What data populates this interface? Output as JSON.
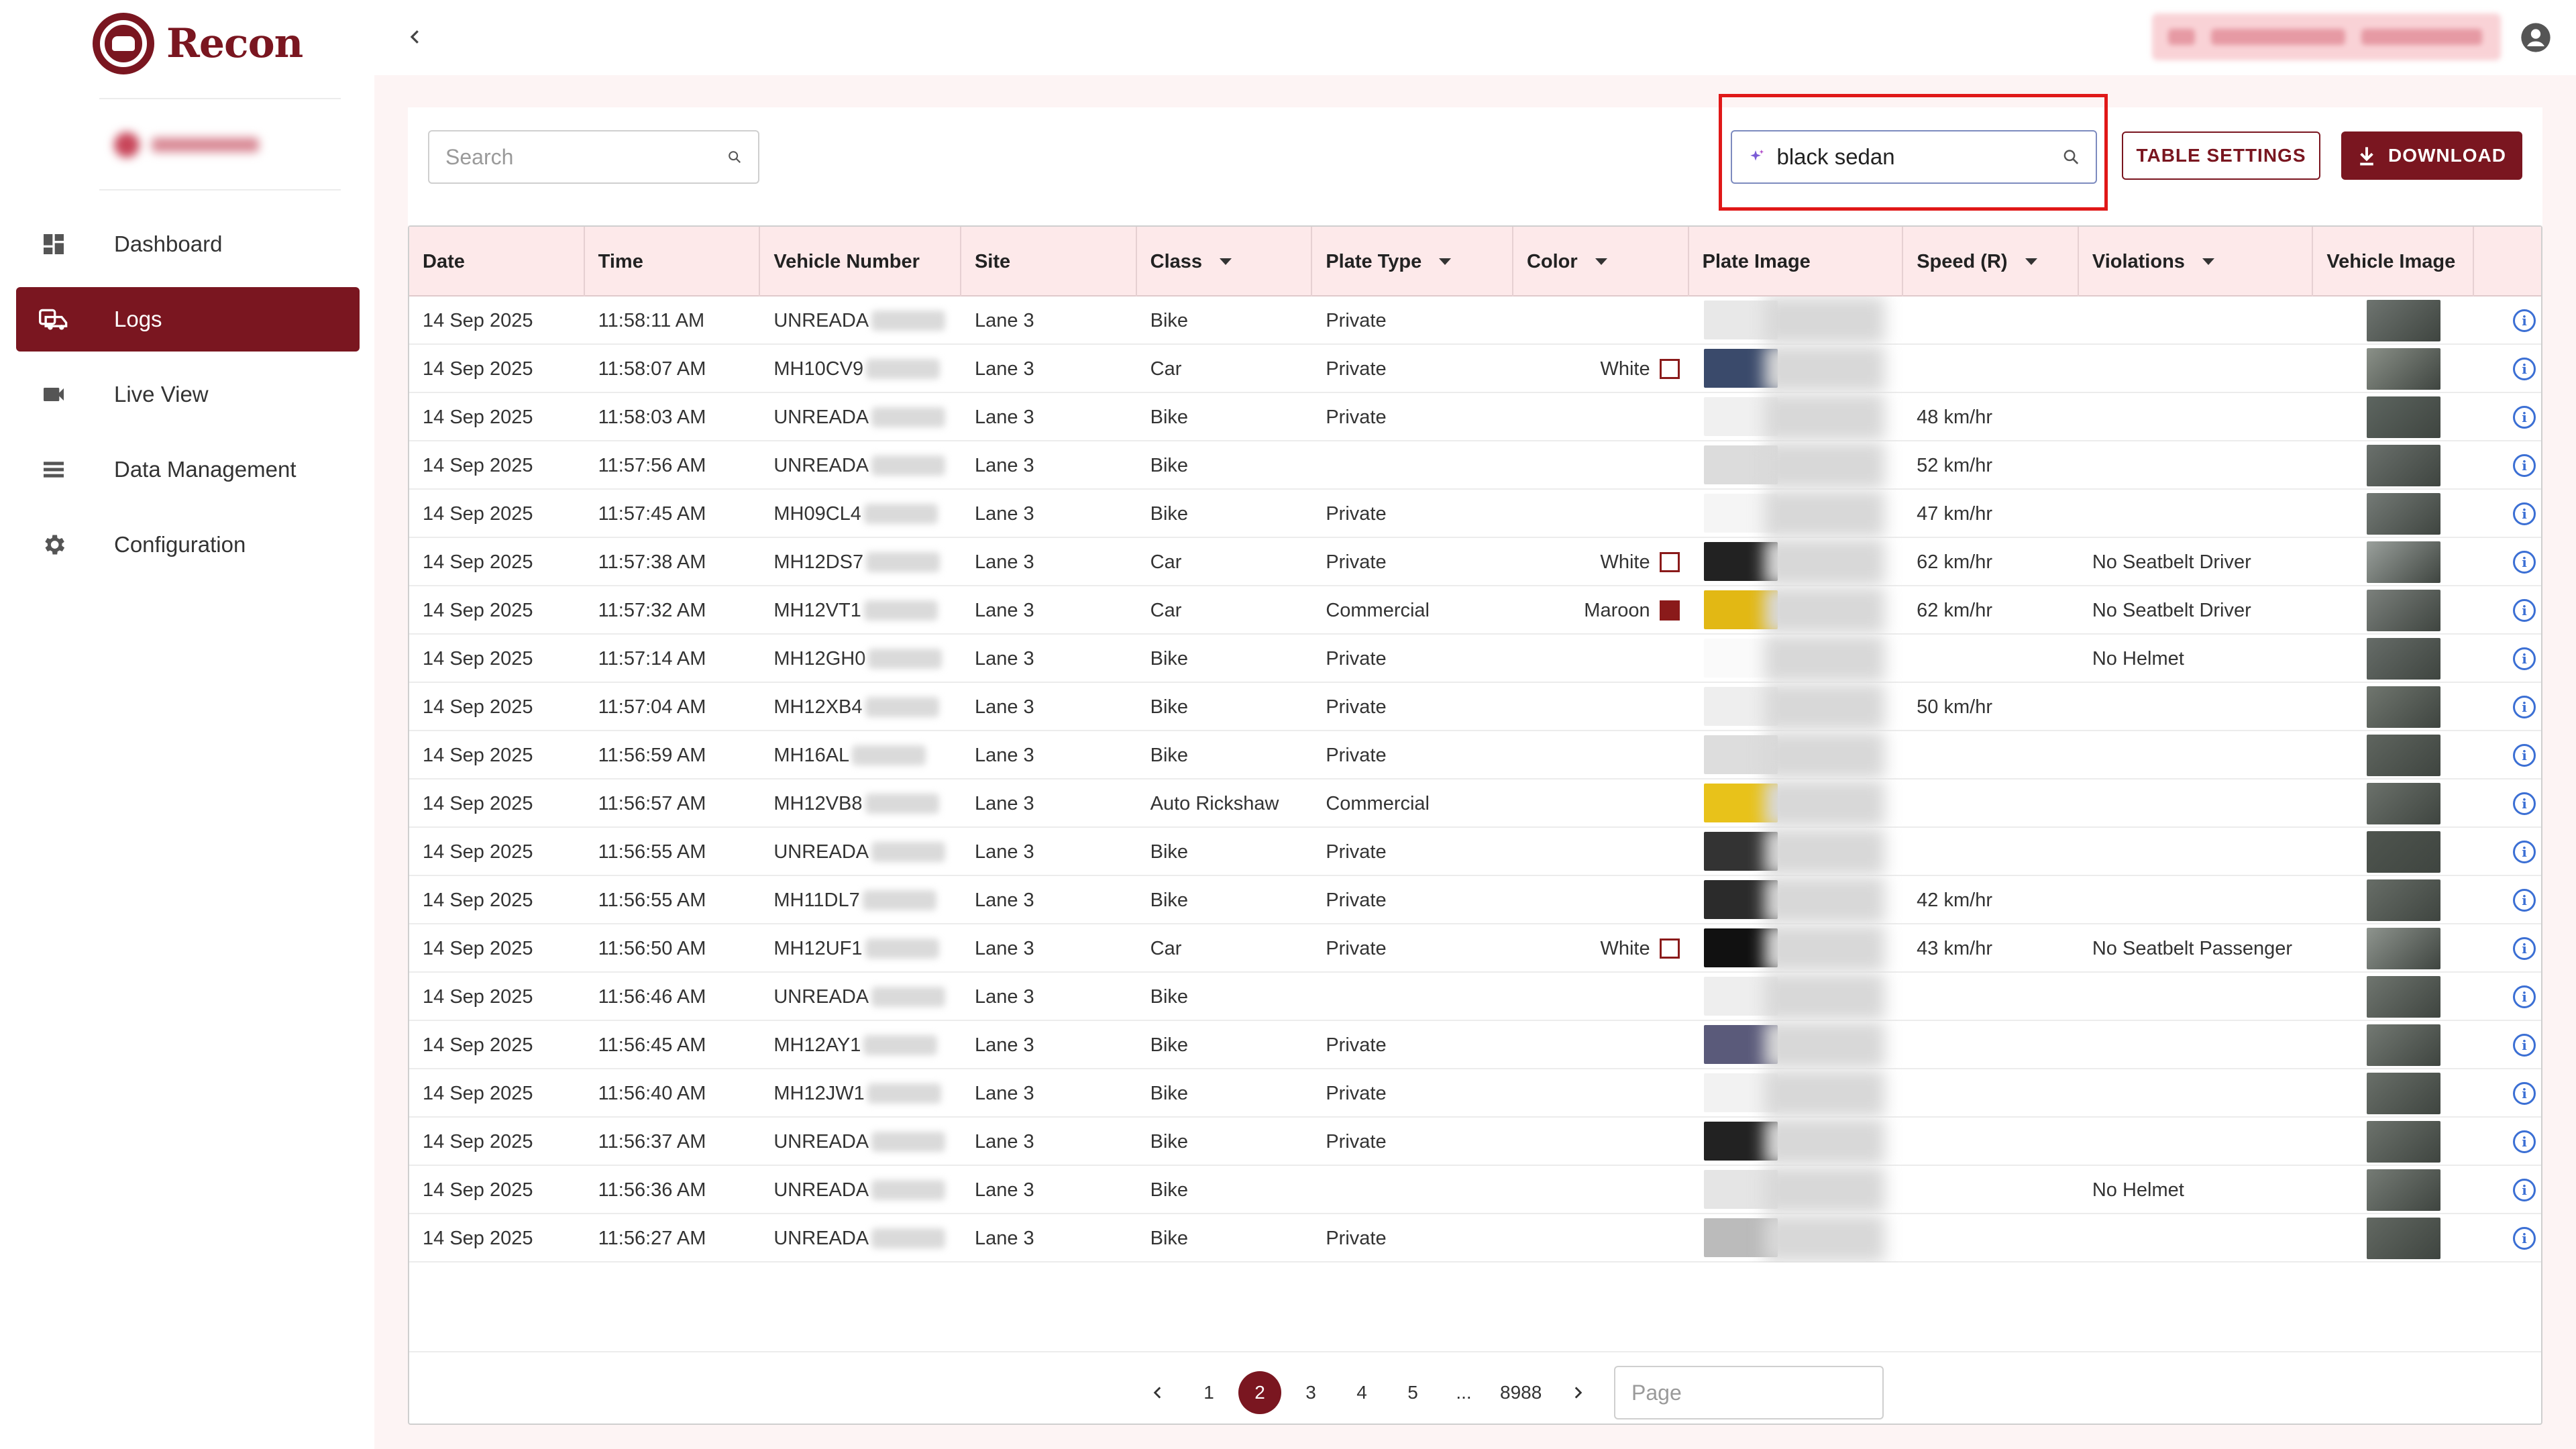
{
  "app": {
    "name": "Recon"
  },
  "colors": {
    "brand": "#7a1620",
    "header_bg": "#fde9ea",
    "highlight": "#e01818",
    "info": "#3b6fd4"
  },
  "sidebar": {
    "items": [
      {
        "label": "Dashboard",
        "icon": "dashboard-icon",
        "active": false
      },
      {
        "label": "Logs",
        "icon": "car-icon",
        "active": true
      },
      {
        "label": "Live View",
        "icon": "video-camera-icon",
        "active": false
      },
      {
        "label": "Data Management",
        "icon": "list-icon",
        "active": false
      },
      {
        "label": "Configuration",
        "icon": "gear-icon",
        "active": false
      }
    ]
  },
  "toolbar": {
    "search_placeholder": "Search",
    "ai_search_value": "black sedan",
    "table_settings_label": "TABLE SETTINGS",
    "download_label": "DOWNLOAD"
  },
  "table": {
    "columns": [
      "Date",
      "Time",
      "Vehicle Number",
      "Site",
      "Class",
      "Plate Type",
      "Color",
      "Plate Image",
      "Speed (R)",
      "Violations",
      "Vehicle Image"
    ],
    "rows": [
      {
        "date": "14 Sep 2025",
        "time": "11:58:11 AM",
        "vnum": "UNREADA",
        "site": "Lane 3",
        "class": "Bike",
        "ptype": "Private",
        "color": "",
        "swatch": "",
        "speed": "",
        "viol": ""
      },
      {
        "date": "14 Sep 2025",
        "time": "11:58:07 AM",
        "vnum": "MH10CV9",
        "site": "Lane 3",
        "class": "Car",
        "ptype": "Private",
        "color": "White",
        "swatch": "#ffffff",
        "speed": "",
        "viol": ""
      },
      {
        "date": "14 Sep 2025",
        "time": "11:58:03 AM",
        "vnum": "UNREADA",
        "site": "Lane 3",
        "class": "Bike",
        "ptype": "Private",
        "color": "",
        "swatch": "",
        "speed": "48 km/hr",
        "viol": ""
      },
      {
        "date": "14 Sep 2025",
        "time": "11:57:56 AM",
        "vnum": "UNREADA",
        "site": "Lane 3",
        "class": "Bike",
        "ptype": "",
        "color": "",
        "swatch": "",
        "speed": "52 km/hr",
        "viol": ""
      },
      {
        "date": "14 Sep 2025",
        "time": "11:57:45 AM",
        "vnum": "MH09CL4",
        "site": "Lane 3",
        "class": "Bike",
        "ptype": "Private",
        "color": "",
        "swatch": "",
        "speed": "47 km/hr",
        "viol": ""
      },
      {
        "date": "14 Sep 2025",
        "time": "11:57:38 AM",
        "vnum": "MH12DS7",
        "site": "Lane 3",
        "class": "Car",
        "ptype": "Private",
        "color": "White",
        "swatch": "#ffffff",
        "speed": "62 km/hr",
        "viol": "No Seatbelt Driver"
      },
      {
        "date": "14 Sep 2025",
        "time": "11:57:32 AM",
        "vnum": "MH12VT1",
        "site": "Lane 3",
        "class": "Car",
        "ptype": "Commercial",
        "color": "Maroon",
        "swatch": "#8a1a1a",
        "speed": "62 km/hr",
        "viol": "No Seatbelt Driver"
      },
      {
        "date": "14 Sep 2025",
        "time": "11:57:14 AM",
        "vnum": "MH12GH0",
        "site": "Lane 3",
        "class": "Bike",
        "ptype": "Private",
        "color": "",
        "swatch": "",
        "speed": "",
        "viol": "No Helmet"
      },
      {
        "date": "14 Sep 2025",
        "time": "11:57:04 AM",
        "vnum": "MH12XB4",
        "site": "Lane 3",
        "class": "Bike",
        "ptype": "Private",
        "color": "",
        "swatch": "",
        "speed": "50 km/hr",
        "viol": ""
      },
      {
        "date": "14 Sep 2025",
        "time": "11:56:59 AM",
        "vnum": "MH16AL",
        "site": "Lane 3",
        "class": "Bike",
        "ptype": "Private",
        "color": "",
        "swatch": "",
        "speed": "",
        "viol": ""
      },
      {
        "date": "14 Sep 2025",
        "time": "11:56:57 AM",
        "vnum": "MH12VB8",
        "site": "Lane 3",
        "class": "Auto Rickshaw",
        "ptype": "Commercial",
        "color": "",
        "swatch": "",
        "speed": "",
        "viol": ""
      },
      {
        "date": "14 Sep 2025",
        "time": "11:56:55 AM",
        "vnum": "UNREADA",
        "site": "Lane 3",
        "class": "Bike",
        "ptype": "Private",
        "color": "",
        "swatch": "",
        "speed": "",
        "viol": ""
      },
      {
        "date": "14 Sep 2025",
        "time": "11:56:55 AM",
        "vnum": "MH11DL7",
        "site": "Lane 3",
        "class": "Bike",
        "ptype": "Private",
        "color": "",
        "swatch": "",
        "speed": "42 km/hr",
        "viol": ""
      },
      {
        "date": "14 Sep 2025",
        "time": "11:56:50 AM",
        "vnum": "MH12UF1",
        "site": "Lane 3",
        "class": "Car",
        "ptype": "Private",
        "color": "White",
        "swatch": "#ffffff",
        "speed": "43 km/hr",
        "viol": "No Seatbelt Passenger"
      },
      {
        "date": "14 Sep 2025",
        "time": "11:56:46 AM",
        "vnum": "UNREADA",
        "site": "Lane 3",
        "class": "Bike",
        "ptype": "",
        "color": "",
        "swatch": "",
        "speed": "",
        "viol": ""
      },
      {
        "date": "14 Sep 2025",
        "time": "11:56:45 AM",
        "vnum": "MH12AY1",
        "site": "Lane 3",
        "class": "Bike",
        "ptype": "Private",
        "color": "",
        "swatch": "",
        "speed": "",
        "viol": ""
      },
      {
        "date": "14 Sep 2025",
        "time": "11:56:40 AM",
        "vnum": "MH12JW1",
        "site": "Lane 3",
        "class": "Bike",
        "ptype": "Private",
        "color": "",
        "swatch": "",
        "speed": "",
        "viol": ""
      },
      {
        "date": "14 Sep 2025",
        "time": "11:56:37 AM",
        "vnum": "UNREADA",
        "site": "Lane 3",
        "class": "Bike",
        "ptype": "Private",
        "color": "",
        "swatch": "",
        "speed": "",
        "viol": ""
      },
      {
        "date": "14 Sep 2025",
        "time": "11:56:36 AM",
        "vnum": "UNREADA",
        "site": "Lane 3",
        "class": "Bike",
        "ptype": "",
        "color": "",
        "swatch": "",
        "speed": "",
        "viol": "No Helmet"
      },
      {
        "date": "14 Sep 2025",
        "time": "11:56:27 AM",
        "vnum": "UNREADA",
        "site": "Lane 3",
        "class": "Bike",
        "ptype": "Private",
        "color": "",
        "swatch": "",
        "speed": "",
        "viol": ""
      }
    ]
  },
  "pagination": {
    "pages": [
      "1",
      "2",
      "3",
      "4",
      "5",
      "...",
      "8988"
    ],
    "current": "2",
    "page_placeholder": "Page"
  }
}
